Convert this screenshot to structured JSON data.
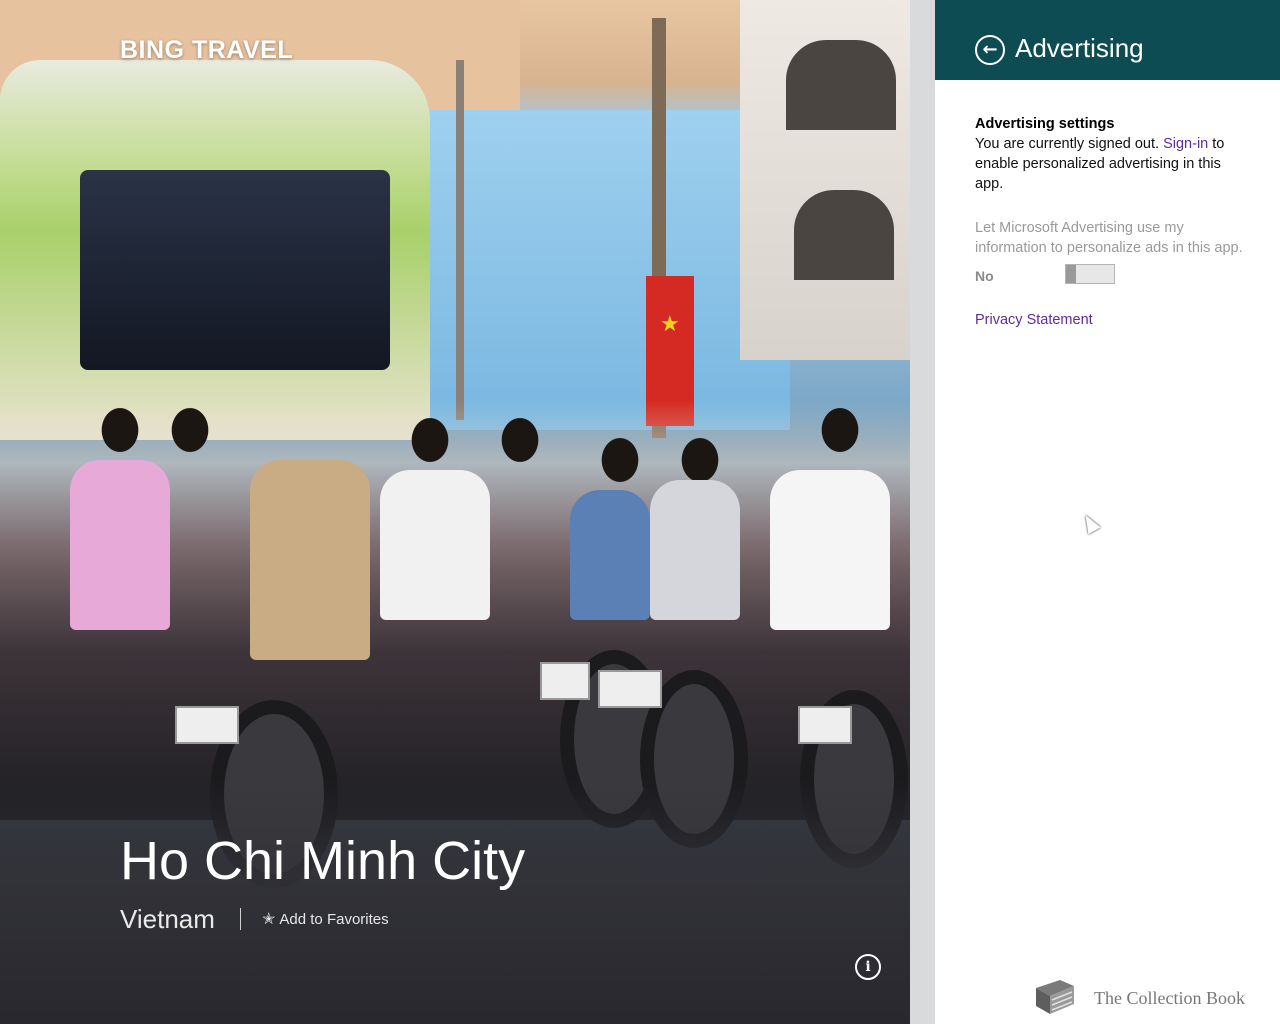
{
  "app": {
    "title": "BING TRAVEL"
  },
  "destination": {
    "city": "Ho Chi Minh City",
    "country": "Vietnam",
    "add_favorites_label": "Add to Favorites",
    "favorites_icon": "star-icon",
    "info_icon": "info-icon"
  },
  "flyout": {
    "title": "Advertising",
    "back_icon": "back-arrow-icon",
    "header_color": "#0c4c52",
    "section_title": "Advertising settings",
    "signed_out_text_1": "You are currently signed out. ",
    "signin_link": "Sign-in",
    "signed_out_text_2": " to enable personalized advertising in this app.",
    "personalize_text": "Let Microsoft Advertising use my information to personalize ads in this app.",
    "toggle_state": "No",
    "privacy_link": "Privacy Statement",
    "link_color": "#5a2e9c"
  },
  "watermark": {
    "text": "The Collection Book",
    "icon": "book-icon"
  }
}
